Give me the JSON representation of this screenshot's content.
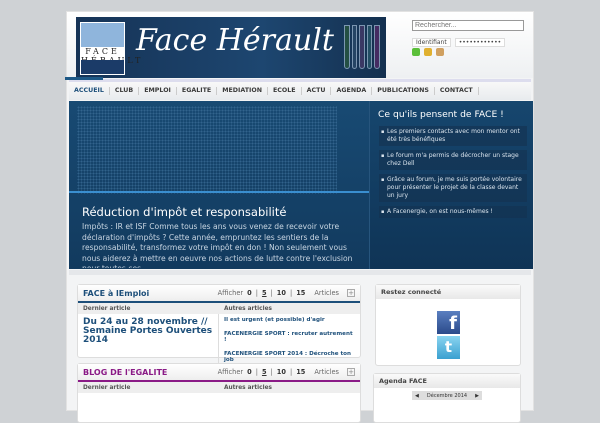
{
  "header": {
    "banner_title": "Face Hérault",
    "logo_text": "FACE HÉRAULT",
    "search_placeholder": "Rechercher...",
    "login_label": "Identifiant",
    "password_mask": "••••••••••••"
  },
  "nav": [
    "ACCUEIL",
    "CLUB",
    "EMPLOI",
    "EGALITE",
    "MEDIATION",
    "ECOLE",
    "ACTU",
    "AGENDA",
    "PUBLICATIONS",
    "CONTACT"
  ],
  "slider": {
    "title": "Réduction d'impôt et responsabilité",
    "text": "Impôts : IR et ISF Comme tous les ans vous venez de recevoir votre déclaration d'impôts ? Cette année, empruntez les sentiers de la responsabilité, transformez votre impôt en don ! Non seulement vous nous aiderez à mettre en oeuvre nos actions de lutte contre l'exclusion pour toutes ces"
  },
  "testimonials": {
    "title": "Ce qu'ils pensent de FACE !",
    "items": [
      "Les premiers contacts avec mon mentor ont été très bénéfiques",
      "Le forum m'a permis de décrocher un stage chez Dell",
      "Grâce au forum, je me suis portée volontaire pour présenter le projet de la classe devant un jury",
      "A Facenergie, on est nous-mêmes !"
    ]
  },
  "widgets": [
    {
      "title": "FACE à lEmploi",
      "color": "#1d4f7a",
      "show": "Afficher",
      "counts": [
        "0",
        "5",
        "10",
        "15"
      ],
      "articles": "Articles",
      "col1": "Dernier article",
      "col2": "Autres articles",
      "lead": "Du 24 au 28 novembre // Semaine Portes Ouvertes 2014",
      "others": [
        "Il est urgent (et possible) d'agir",
        "FACENERGIE SPORT : recruter autrement !",
        "FACENERGIE SPORT 2014 : Décroche ton job"
      ]
    },
    {
      "title": "BLOG DE l'EGALITE",
      "color": "#8a1a86",
      "show": "Afficher",
      "counts": [
        "0",
        "5",
        "10",
        "15"
      ],
      "articles": "Articles",
      "col1": "Dernier article",
      "col2": "Autres articles"
    }
  ],
  "sidebar": {
    "social_title": "Restez connecté",
    "agenda_title": "Agenda FACE",
    "month": "Décembre 2014"
  }
}
